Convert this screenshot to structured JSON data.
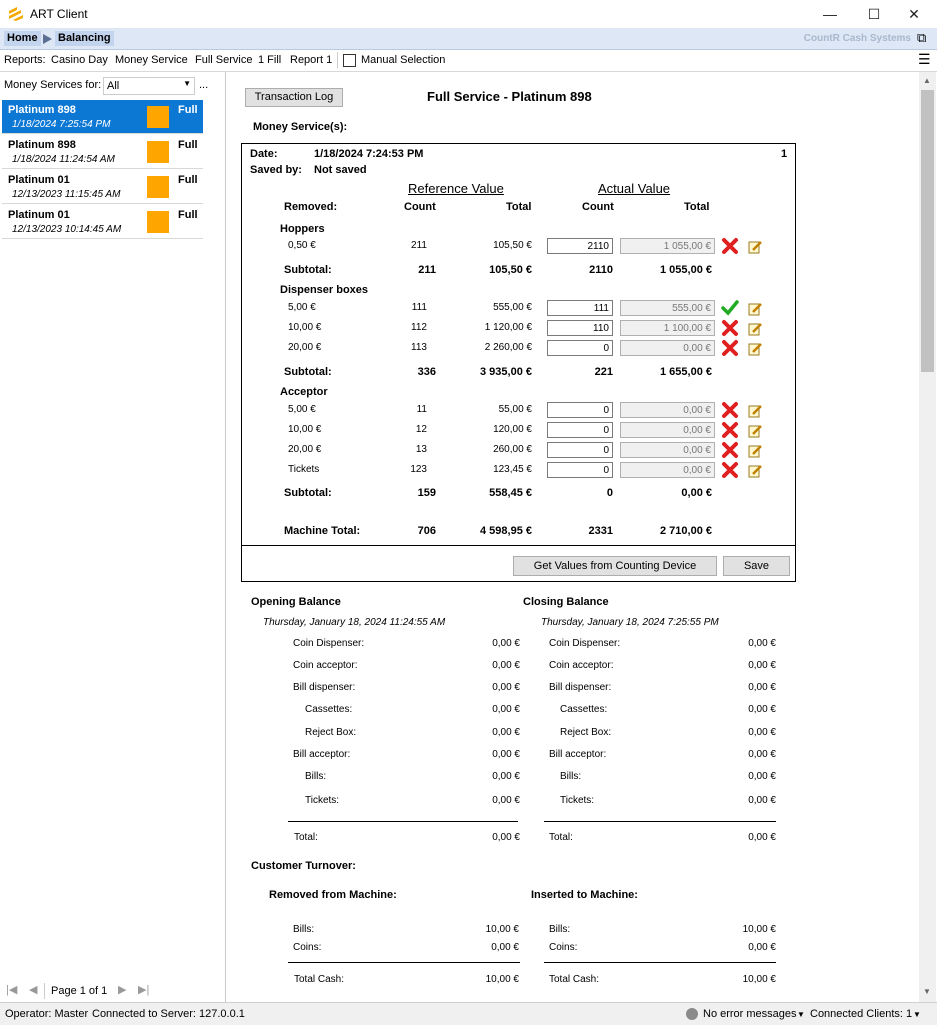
{
  "app": {
    "title": "ART Client",
    "brand": "CountR Cash Systems"
  },
  "breadcrumb": {
    "home": "Home",
    "current": "Balancing"
  },
  "reports": {
    "label": "Reports:",
    "items": [
      "Casino Day",
      "Money Service",
      "Full Service",
      "1 Fill",
      "Report 1"
    ],
    "manual_selection": "Manual Selection"
  },
  "left": {
    "filter_label": "Money Services for:",
    "filter_value": "All",
    "more": "...",
    "items": [
      {
        "name": "Platinum 898",
        "date": "1/18/2024 7:25:54 PM",
        "type": "Full"
      },
      {
        "name": "Platinum 898",
        "date": "1/18/2024 11:24:54 AM",
        "type": "Full"
      },
      {
        "name": "Platinum 01",
        "date": "12/13/2023 11:15:45 AM",
        "type": "Full"
      },
      {
        "name": "Platinum 01",
        "date": "12/13/2023 10:14:45 AM",
        "type": "Full"
      }
    ],
    "pager": "Page 1 of 1"
  },
  "main": {
    "transaction_log": "Transaction Log",
    "heading": "Full Service - Platinum 898",
    "money_services": "Money Service(s):",
    "date_label": "Date:",
    "date_value": "1/18/2024 7:24:53 PM",
    "page_num": "1",
    "saved_label": "Saved by:",
    "saved_value": "Not saved",
    "ref_header": "Reference Value",
    "act_header": "Actual Value",
    "removed": "Removed:",
    "count": "Count",
    "total": "Total",
    "hoppers": "Hoppers",
    "dispenser": "Dispenser boxes",
    "acceptor": "Acceptor",
    "subtotal": "Subtotal:",
    "machine_total": "Machine Total:",
    "rows_hoppers": [
      {
        "label": "0,50 €",
        "ref_count": "211",
        "ref_total": "105,50 €",
        "act_count": "2110",
        "act_total": "1 055,00 €",
        "status": "x"
      }
    ],
    "sub_hoppers": {
      "ref_count": "211",
      "ref_total": "105,50 €",
      "act_count": "2110",
      "act_total": "1 055,00 €"
    },
    "rows_dispenser": [
      {
        "label": "5,00 €",
        "ref_count": "111",
        "ref_total": "555,00 €",
        "act_count": "111",
        "act_total": "555,00 €",
        "status": "check"
      },
      {
        "label": "10,00 €",
        "ref_count": "112",
        "ref_total": "1 120,00 €",
        "act_count": "110",
        "act_total": "1 100,00 €",
        "status": "x"
      },
      {
        "label": "20,00 €",
        "ref_count": "113",
        "ref_total": "2 260,00 €",
        "act_count": "0",
        "act_total": "0,00 €",
        "status": "x"
      }
    ],
    "sub_dispenser": {
      "ref_count": "336",
      "ref_total": "3 935,00 €",
      "act_count": "221",
      "act_total": "1 655,00 €"
    },
    "rows_acceptor": [
      {
        "label": "5,00 €",
        "ref_count": "11",
        "ref_total": "55,00 €",
        "act_count": "0",
        "act_total": "0,00 €",
        "status": "x"
      },
      {
        "label": "10,00 €",
        "ref_count": "12",
        "ref_total": "120,00 €",
        "act_count": "0",
        "act_total": "0,00 €",
        "status": "x"
      },
      {
        "label": "20,00 €",
        "ref_count": "13",
        "ref_total": "260,00 €",
        "act_count": "0",
        "act_total": "0,00 €",
        "status": "x"
      },
      {
        "label": "Tickets",
        "ref_count": "123",
        "ref_total": "123,45 €",
        "act_count": "0",
        "act_total": "0,00 €",
        "status": "x"
      }
    ],
    "sub_acceptor": {
      "ref_count": "159",
      "ref_total": "558,45 €",
      "act_count": "0",
      "act_total": "0,00 €"
    },
    "machine": {
      "ref_count": "706",
      "ref_total": "4 598,95 €",
      "act_count": "2331",
      "act_total": "2 710,00 €"
    },
    "get_values": "Get Values from Counting Device",
    "save": "Save"
  },
  "balance": {
    "opening_title": "Opening Balance",
    "opening_date": "Thursday, January 18, 2024 11:24:55 AM",
    "closing_title": "Closing Balance",
    "closing_date": "Thursday, January 18, 2024 7:25:55 PM",
    "rows": [
      {
        "label": "Coin Dispenser:",
        "indent": false,
        "open": "0,00 €",
        "close": "0,00 €"
      },
      {
        "label": "Coin acceptor:",
        "indent": false,
        "open": "0,00 €",
        "close": "0,00 €"
      },
      {
        "label": "Bill dispenser:",
        "indent": false,
        "open": "0,00 €",
        "close": "0,00 €"
      },
      {
        "label": "Cassettes:",
        "indent": true,
        "open": "0,00 €",
        "close": "0,00 €"
      },
      {
        "label": "Reject Box:",
        "indent": true,
        "open": "0,00 €",
        "close": "0,00 €"
      },
      {
        "label": "Bill acceptor:",
        "indent": false,
        "open": "0,00 €",
        "close": "0,00 €"
      },
      {
        "label": "Bills:",
        "indent": true,
        "open": "0,00 €",
        "close": "0,00 €"
      },
      {
        "label": "Tickets:",
        "indent": true,
        "open": "0,00 €",
        "close": "0,00 €"
      }
    ],
    "total_label": "Total:",
    "open_total": "0,00 €",
    "close_total": "0,00 €"
  },
  "turnover": {
    "title": "Customer Turnover:",
    "removed_title": "Removed from Machine:",
    "inserted_title": "Inserted to Machine:",
    "bills_label": "Bills:",
    "coins_label": "Coins:",
    "total_label": "Total Cash:",
    "removed": {
      "bills": "10,00 €",
      "coins": "0,00 €",
      "total": "10,00 €"
    },
    "inserted": {
      "bills": "10,00 €",
      "coins": "0,00 €",
      "total": "10,00 €"
    }
  },
  "status": {
    "operator": "Operator: Master",
    "server": "Connected to Server: 127.0.0.1",
    "errors": "No error messages",
    "clients": "Connected Clients: 1"
  },
  "colors": {
    "selected": "#0d78d4",
    "orange": "#ffa500",
    "breadcrumb": "#dde7f5"
  }
}
